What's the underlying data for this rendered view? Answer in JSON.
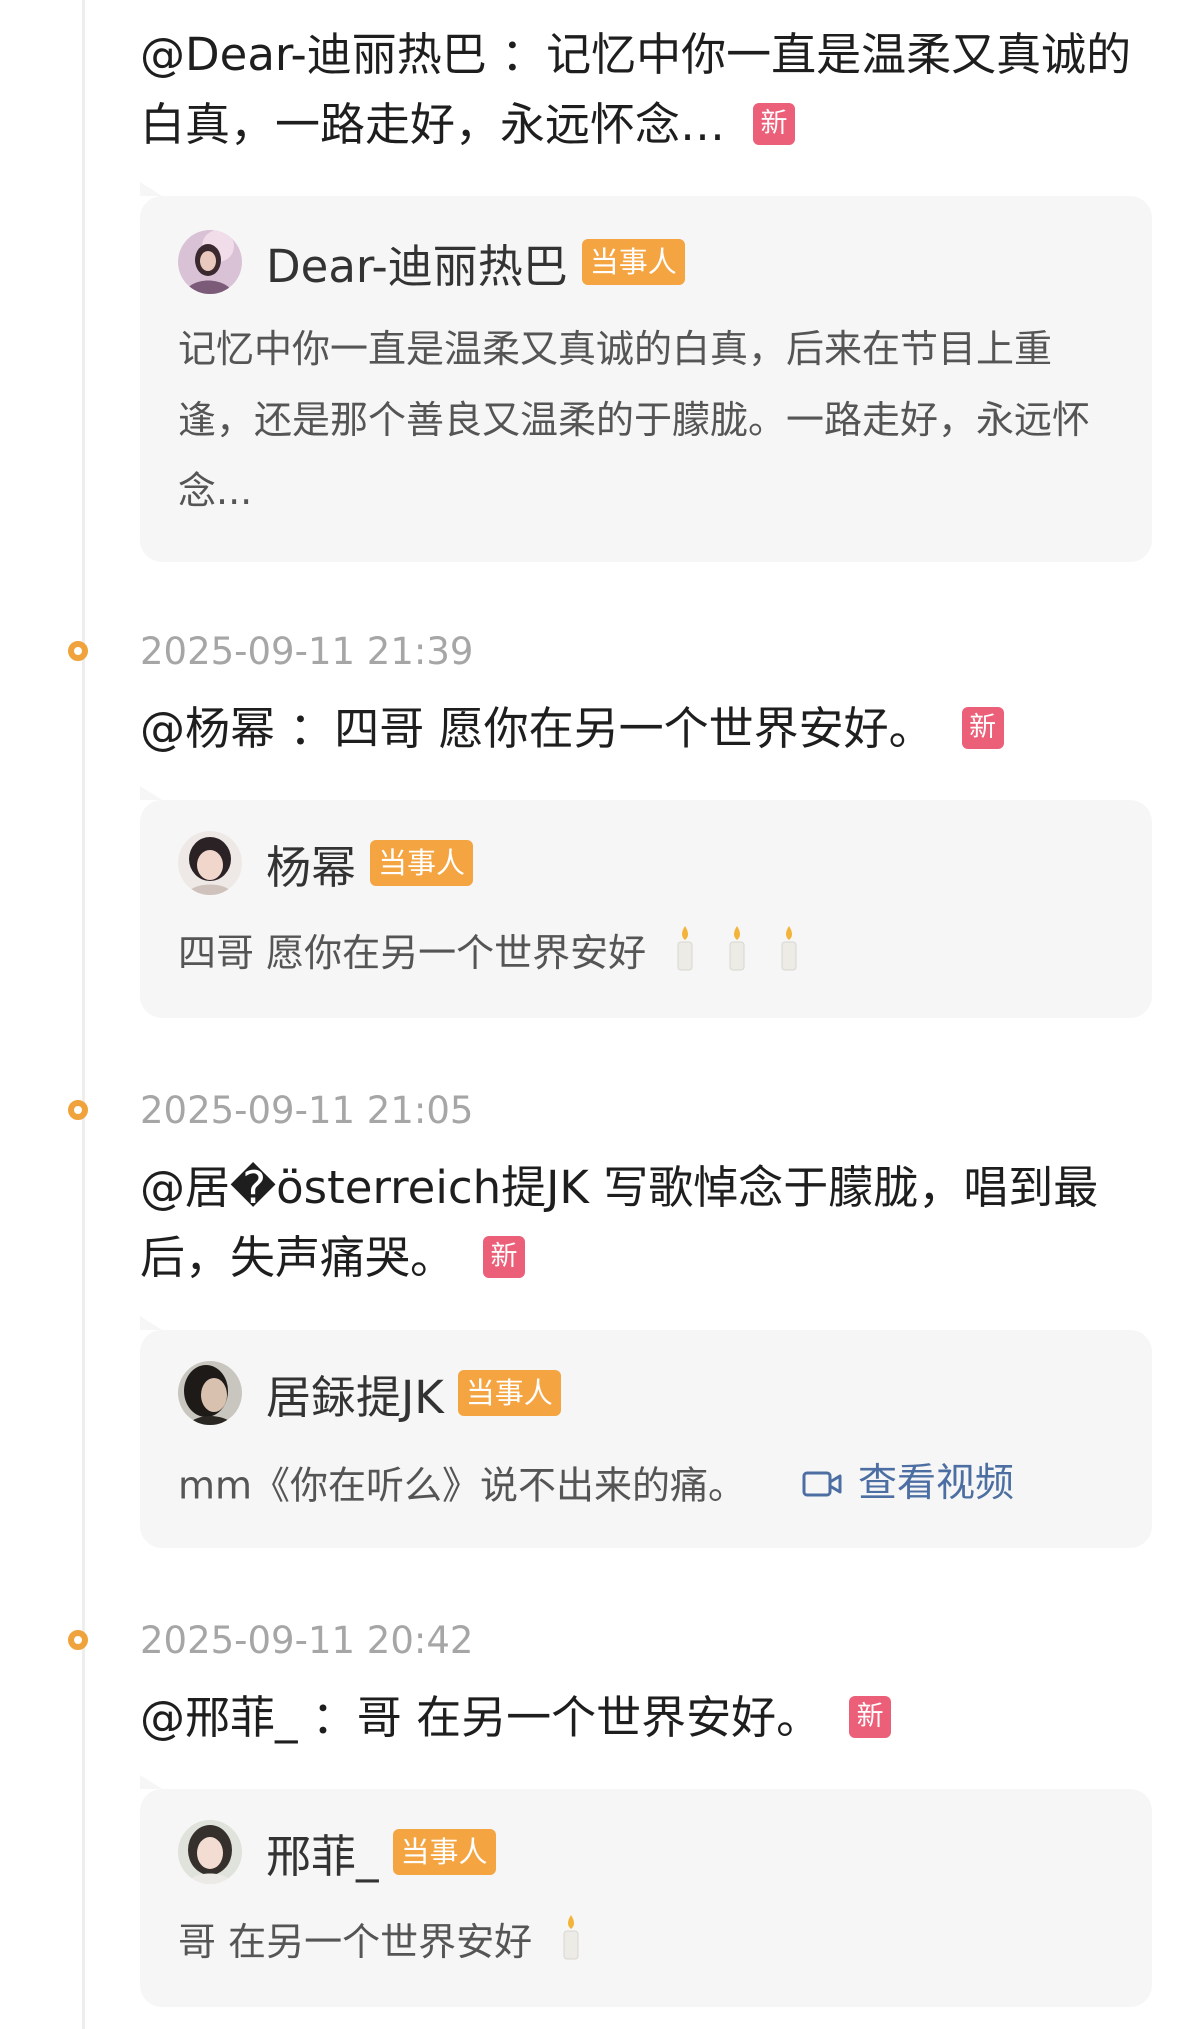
{
  "entries": [
    {
      "timestamp": "",
      "headline": "@Dear-迪丽热巴 ：记忆中你一直是温柔又真诚的白真，一路走好，永远怀念…",
      "badge": "新",
      "card": {
        "author": "Dear-迪丽热巴",
        "role_badge": "当事人",
        "text": "记忆中你一直是温柔又真诚的白真，后来在节目上重逢，还是那个善良又温柔的于朦胧。一路走好，永远怀念..."
      }
    },
    {
      "timestamp": "2025-09-11 21:39",
      "headline": "@杨幂 ：四哥 愿你在另一个世界安好。",
      "badge": "新",
      "card": {
        "author": "杨幂",
        "role_badge": "当事人",
        "text": "四哥 愿你在另一个世界安好",
        "emoji": [
          "candle-icon",
          "candle-icon",
          "candle-icon"
        ]
      }
    },
    {
      "timestamp": "2025-09-11 21:05",
      "headline": "@居�österreich提JK 写歌悼念于朦胧，唱到最后，失声痛哭。",
      "badge": "新",
      "card": {
        "author": "居銾提JK",
        "role_badge": "当事人",
        "text": "mm《你在听么》说不出来的痛。",
        "link_label": "查看视频"
      }
    },
    {
      "timestamp": "2025-09-11 20:42",
      "headline": "@邢菲_ ：哥 在另一个世界安好。",
      "badge": "新",
      "card": {
        "author": "邢菲_",
        "role_badge": "当事人",
        "text": "哥 在另一个世界安好",
        "emoji": [
          "candle-icon"
        ]
      }
    }
  ],
  "colors": {
    "timeline_dot": "#f0a33c",
    "new_badge": "#ec5f78",
    "party_badge": "#f5a442",
    "link": "#4c6ea2",
    "card_background": "#f6f6f6",
    "timestamp": "#a6a6a6"
  }
}
